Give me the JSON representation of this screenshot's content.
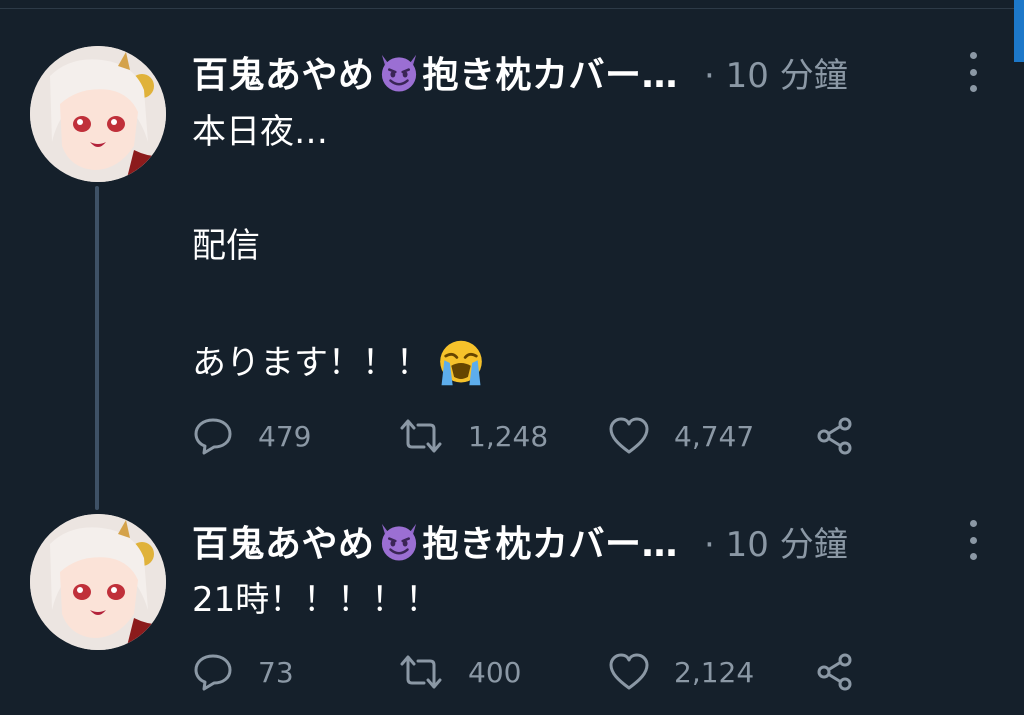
{
  "thread": {
    "tweets": [
      {
        "author": "百鬼あやめ",
        "author_suffix": "抱き枕カバー…",
        "author_emoji": "smiling-devil-emoji",
        "meta": "· 10 分鐘",
        "text_lines": [
          "本日夜…",
          "",
          "配信",
          "",
          "あります！！！"
        ],
        "text_emoji": "loudly-crying-emoji",
        "actions": {
          "replies": "479",
          "retweets": "1,248",
          "likes": "4,747"
        }
      },
      {
        "author": "百鬼あやめ",
        "author_suffix": "抱き枕カバー…",
        "author_emoji": "smiling-devil-emoji",
        "meta": "· 10 分鐘",
        "text_lines": [
          "21時！！！！！"
        ],
        "actions": {
          "replies": "73",
          "retweets": "400",
          "likes": "2,124"
        }
      }
    ]
  },
  "colors": {
    "background": "#15202b",
    "primary_text": "#ffffff",
    "secondary_text": "#8b98a5",
    "thread_line": "#3e5166",
    "scroll_accent": "#1d78c9"
  }
}
